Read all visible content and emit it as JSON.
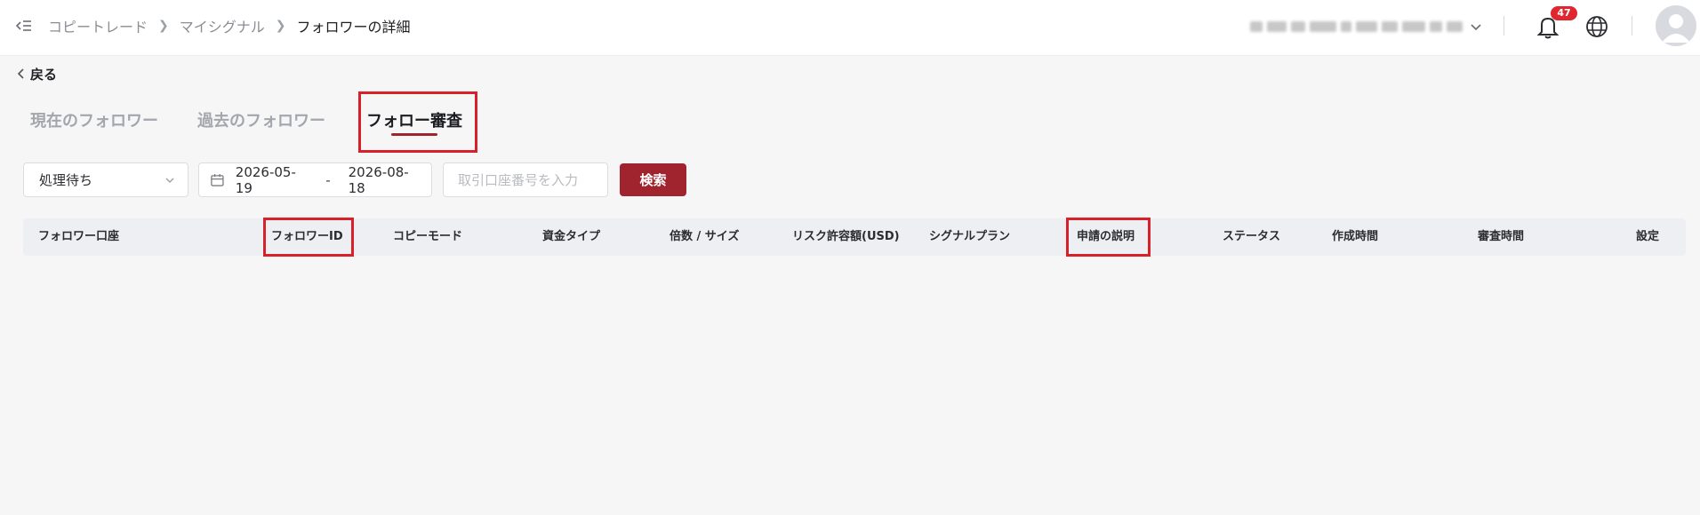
{
  "header": {
    "breadcrumb": [
      "コピートレード",
      "マイシグナル",
      "フォロワーの詳細"
    ],
    "notifications_count": "47"
  },
  "back": {
    "label": "戻る"
  },
  "tabs": [
    {
      "label": "現在のフォロワー",
      "active": false
    },
    {
      "label": "過去のフォロワー",
      "active": false
    },
    {
      "label": "フォロー審査",
      "active": true
    }
  ],
  "filters": {
    "status_selected": "処理待ち",
    "date_start": "2026-05-19",
    "date_separator": "-",
    "date_end": "2026-08-18",
    "account_placeholder": "取引口座番号を入力",
    "search_label": "検索"
  },
  "table": {
    "columns": [
      "フォロワー口座",
      "フォロワーID",
      "コピーモード",
      "資金タイプ",
      "倍数 / サイズ",
      "リスク許容額(USD)",
      "シグナルプラン",
      "申請の説明",
      "ステータス",
      "作成時間",
      "審査時間",
      "設定"
    ],
    "rows": []
  },
  "colors": {
    "accent": "#a0242e",
    "highlight": "#d8202a",
    "badge": "#e0262f"
  }
}
